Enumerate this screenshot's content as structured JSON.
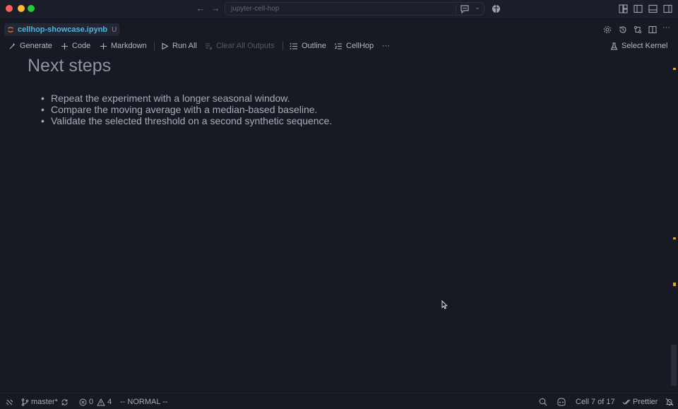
{
  "titlebar": {
    "search_text": "jupyter-cell-hop"
  },
  "tab": {
    "label": "cellhop-showcase.ipynb",
    "modified": "U"
  },
  "toolbar": {
    "generate": "Generate",
    "code": "Code",
    "markdown": "Markdown",
    "run_all": "Run All",
    "clear_all_outputs": "Clear All Outputs",
    "outline": "Outline",
    "cellhop": "CellHop",
    "more": "···",
    "select_kernel": "Select Kernel"
  },
  "content": {
    "heading": "Next steps",
    "bullets": [
      "Repeat the experiment with a longer seasonal window.",
      "Compare the moving average with a median-based baseline.",
      "Validate the selected threshold on a second synthetic sequence."
    ]
  },
  "statusbar": {
    "branch": "master*",
    "errors": "0",
    "warnings": "4",
    "mode": "-- NORMAL --",
    "cell_position": "Cell 7 of 17",
    "formatter": "Prettier"
  },
  "colors": {
    "background": "#171923",
    "tab_label": "#4fb4d8",
    "scroll_marker": "#d8a53c"
  }
}
